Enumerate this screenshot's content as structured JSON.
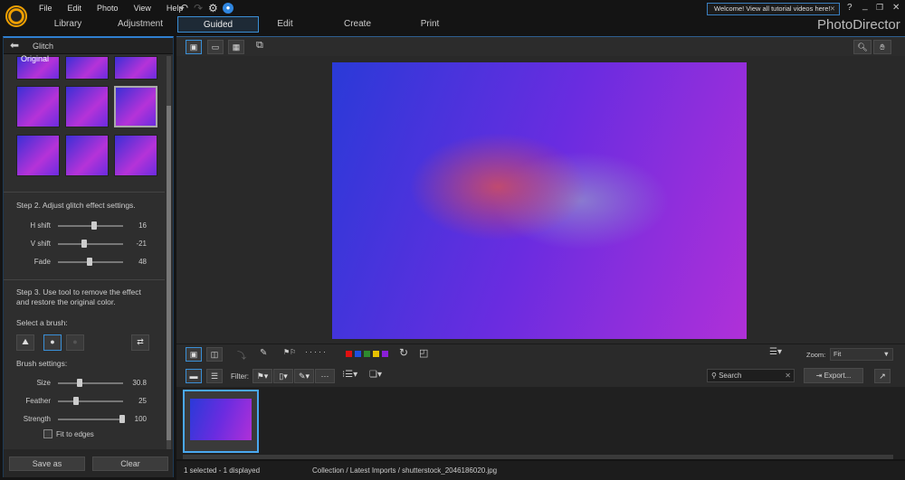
{
  "menu": [
    "File",
    "Edit",
    "Photo",
    "View",
    "Help"
  ],
  "tabs": [
    "Library",
    "Adjustment",
    "Guided",
    "Edit",
    "Create",
    "Print"
  ],
  "active_tab": "Guided",
  "tooltip": "Welcome! View all tutorial videos here!",
  "brand": "PhotoDirector",
  "panel": {
    "title": "Glitch",
    "original_label": "Original",
    "step2": "Step 2. Adjust glitch effect settings.",
    "sliders": [
      {
        "label": "H shift",
        "value": "16",
        "pos": 0.55
      },
      {
        "label": "V shift",
        "value": "-21",
        "pos": 0.38
      },
      {
        "label": "Fade",
        "value": "48",
        "pos": 0.47
      }
    ],
    "step3": "Step 3. Use tool to remove the effect and restore the original color.",
    "select_brush": "Select a brush:",
    "brush_settings": "Brush settings:",
    "brush_sliders": [
      {
        "label": "Size",
        "value": "30.8",
        "pos": 0.31
      },
      {
        "label": "Feather",
        "value": "25",
        "pos": 0.25
      },
      {
        "label": "Strength",
        "value": "100",
        "pos": 1.0
      }
    ],
    "fit_edges": "Fit to edges",
    "save_as": "Save as",
    "clear": "Clear"
  },
  "toolbar": {
    "zoom_label": "Zoom:",
    "zoom_value": "Fit",
    "filter_label": "Filter:",
    "search_placeholder": "Search",
    "export": "Export..."
  },
  "color_labels": [
    "#e01010",
    "#1f4fe0",
    "#2e8a2e",
    "#e8c000",
    "#8a1fd8"
  ],
  "status": {
    "selection": "1 selected - 1 displayed",
    "path": "Collection / Latest Imports / shutterstock_2046186020.jpg"
  }
}
